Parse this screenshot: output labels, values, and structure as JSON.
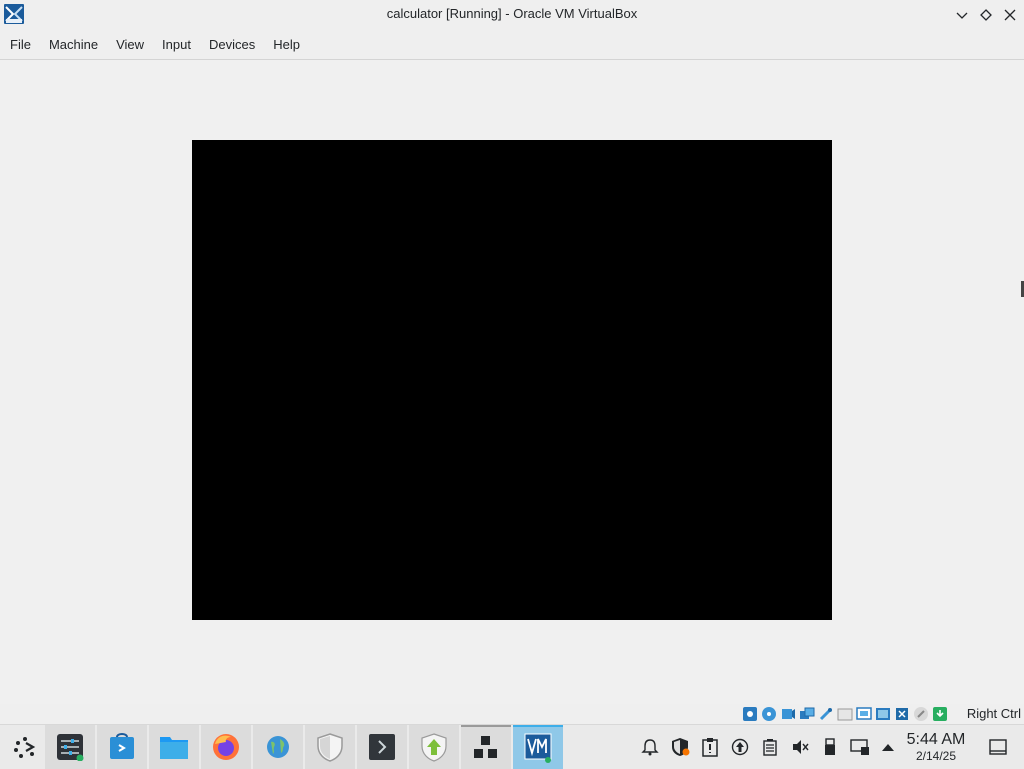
{
  "window": {
    "title": "calculator [Running] - Oracle VM VirtualBox",
    "app_icon": "virtualbox-icon"
  },
  "menubar": {
    "items": [
      "File",
      "Machine",
      "View",
      "Input",
      "Devices",
      "Help"
    ]
  },
  "statusbar": {
    "icons": [
      "hard-disk-icon",
      "optical-drive-icon",
      "audio-icon",
      "network-icon",
      "usb-icon",
      "shared-folders-icon",
      "display-icon",
      "recording-icon",
      "cpu-icon",
      "mouse-integration-icon"
    ],
    "host_key": "Right Ctrl"
  },
  "taskbar": {
    "apps": [
      "application-launcher-icon",
      "system-settings-icon",
      "discover-store-icon",
      "file-manager-icon",
      "firefox-icon",
      "globe-icon",
      "shield-icon",
      "terminal-icon",
      "update-icon",
      "overview-icon",
      "virtualbox-icon"
    ],
    "tray": [
      "notifications-icon",
      "security-icon",
      "clipboard-icon",
      "updates-icon",
      "battery-icon",
      "volume-muted-icon",
      "usb-device-icon",
      "network-icon",
      "show-hidden-icon",
      "show-desktop-icon"
    ],
    "clock": {
      "time": "5:44 AM",
      "date": "2/14/25"
    }
  },
  "colors": {
    "accent": "#3daee9",
    "vm_screen": "#000000"
  }
}
